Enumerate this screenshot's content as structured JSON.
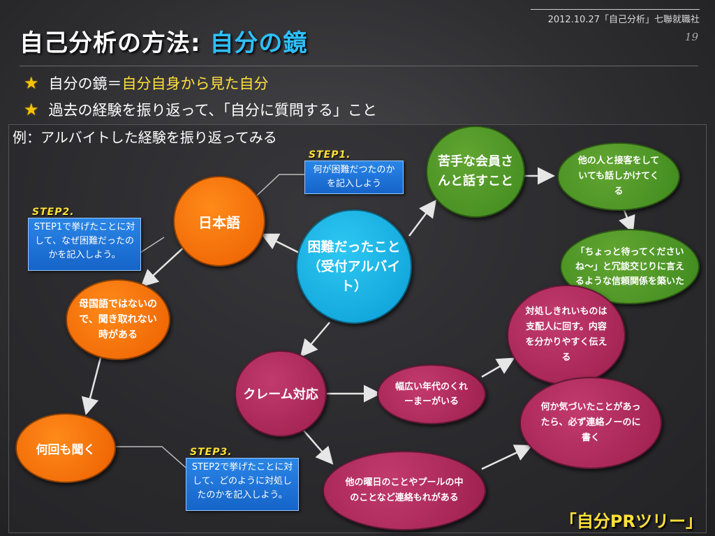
{
  "header": {
    "date_source": "2012.10.27「自己分析」七聯就職社",
    "page": "19"
  },
  "title": {
    "main": "自己分析の方法: ",
    "accent": "自分の鏡"
  },
  "bullets": {
    "b1_pre": "自分の鏡＝",
    "b1_hl": "自分自身から見た自分",
    "b2": "過去の経験を振り返って、「自分に質問する」こと"
  },
  "example_label": "例：アルバイトした経験を振り返ってみる",
  "nodes": {
    "center": "困難だったこと（受付アルバイト）",
    "nihongo": "日本語",
    "bokokugo": "母国語ではないので、聞き取れない時がある",
    "nankai": "何回も聞く",
    "nigate": "苦手な会員さんと話すこと",
    "hoka": "他の人と接客をしていても話しかけてくる",
    "chotto": "「ちょっと待ってくださいね〜」と冗談交じりに言えるような信頼関係を築いた",
    "claim": "クレーム対応",
    "habahiroi": "幅広い年代のくれーまーがいる",
    "taisho": "対処しきれいものは支配人に回す。内容を分かりやすく伝える",
    "nanika": "何か気づいたことがあったら、必ず連絡ノーのに書く",
    "yobi": "他の曜日のことやプールの中のことなど連絡もれがある"
  },
  "steps": {
    "s1_label": "STEP1.",
    "s1_text": "何が困難だつたのかを記入しよう",
    "s2_label": "STEP2.",
    "s2_text": "STEP1で挙げたことに対して、なぜ困難だったのかを記入しよう。",
    "s3_label": "STEP3.",
    "s3_text": "STEP2で挙げたことに対して、どのように対処したのかを記入しよう。"
  },
  "footer": "「自分PRツリー」",
  "colors": {
    "accent": "#2ec0ff",
    "highlight": "#ffe13a",
    "orange": "#ec5f00",
    "blue": "#0a9ed6",
    "green": "#3f8a1e",
    "crimson": "#9c1f4d"
  }
}
